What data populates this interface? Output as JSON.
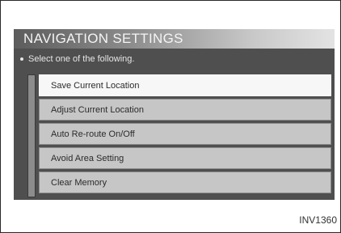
{
  "screen": {
    "title": "NAVIGATION SETTINGS",
    "instruction": "Select one of the following.",
    "menu_items": [
      {
        "label": "Save Current Location",
        "selected": true
      },
      {
        "label": "Adjust Current Location",
        "selected": false
      },
      {
        "label": "Auto Re-route On/Off",
        "selected": false
      },
      {
        "label": "Avoid Area Setting",
        "selected": false
      },
      {
        "label": "Clear Memory",
        "selected": false
      }
    ]
  },
  "figure": {
    "reference_code": "INV1360"
  }
}
